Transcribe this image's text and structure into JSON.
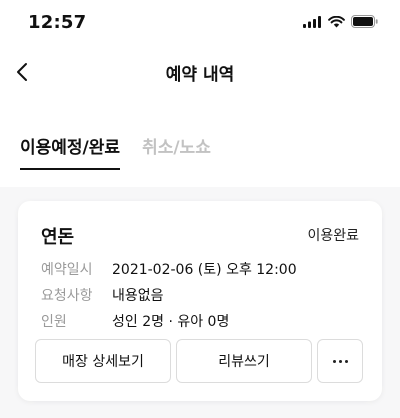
{
  "status_bar": {
    "time": "12:57"
  },
  "header": {
    "title": "예약 내역"
  },
  "tabs": [
    {
      "label": "이용예정/완료",
      "active": true
    },
    {
      "label": "취소/노쇼",
      "active": false
    }
  ],
  "reservation": {
    "store_name": "연돈",
    "status": "이용완료",
    "fields": [
      {
        "label": "예약일시",
        "value": "2021-02-06 (토) 오후 12:00"
      },
      {
        "label": "요청사항",
        "value": "내용없음"
      },
      {
        "label": "인원",
        "value": "성인 2명 · 유아 0명"
      }
    ],
    "buttons": {
      "store_detail": "매장 상세보기",
      "write_review": "리뷰쓰기"
    }
  }
}
